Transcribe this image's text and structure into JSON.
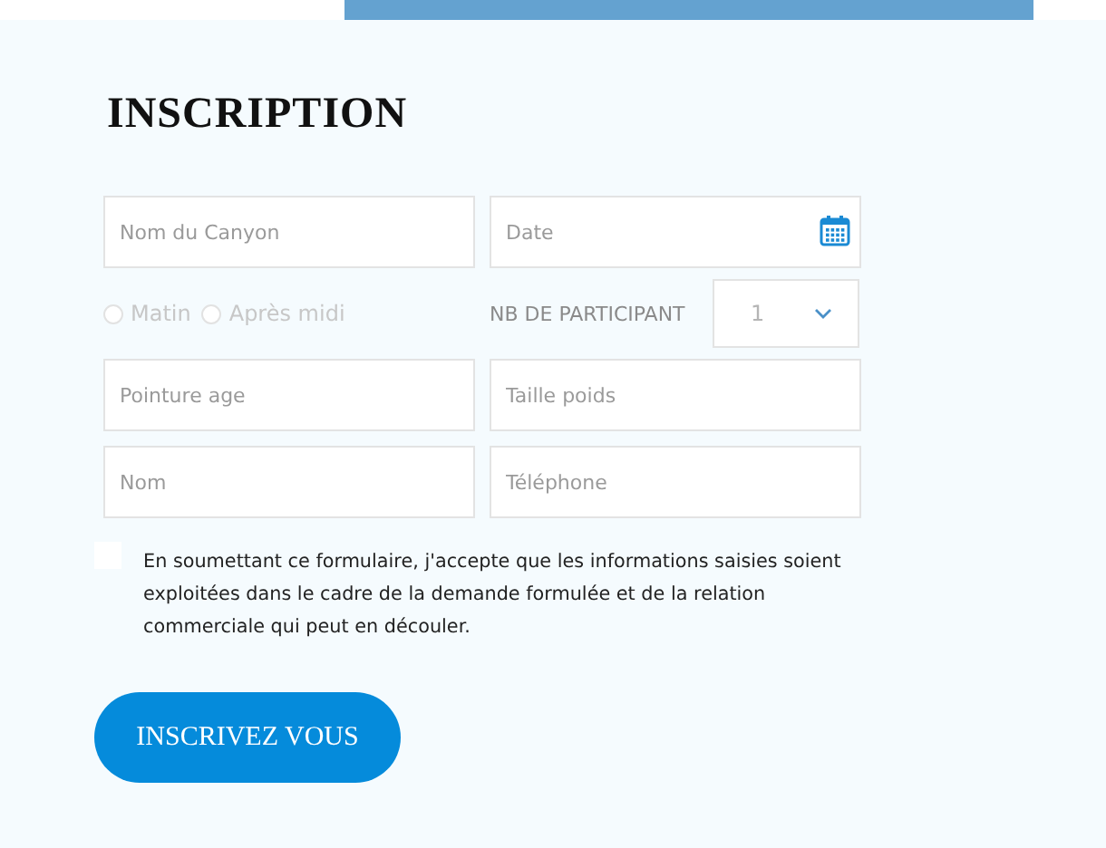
{
  "title": "INSCRIPTION",
  "fields": [
    {
      "kind": "text",
      "placeholder": "Nom du Canyon"
    },
    {
      "kind": "date",
      "placeholder": "Date"
    }
  ],
  "slots": [
    {
      "label": "Matin",
      "selected": false
    },
    {
      "label": "Après midi",
      "selected": false
    }
  ],
  "participants": {
    "label": "NB DE PARTICIPANT",
    "value": "1"
  },
  "fields_2": [
    {
      "kind": "text",
      "placeholder": "Pointure age"
    },
    {
      "kind": "text",
      "placeholder": "Taille poids"
    },
    {
      "kind": "text",
      "placeholder": "Nom"
    },
    {
      "kind": "text",
      "placeholder": "Téléphone"
    }
  ],
  "consent": {
    "checked": false,
    "text": "En soumettant ce formulaire, j'accepte que les informations saisies soient exploitées dans le cadre de la demande formulée et de la relation commerciale qui peut en découler."
  },
  "submit": "INSCRIVEZ VOUS"
}
